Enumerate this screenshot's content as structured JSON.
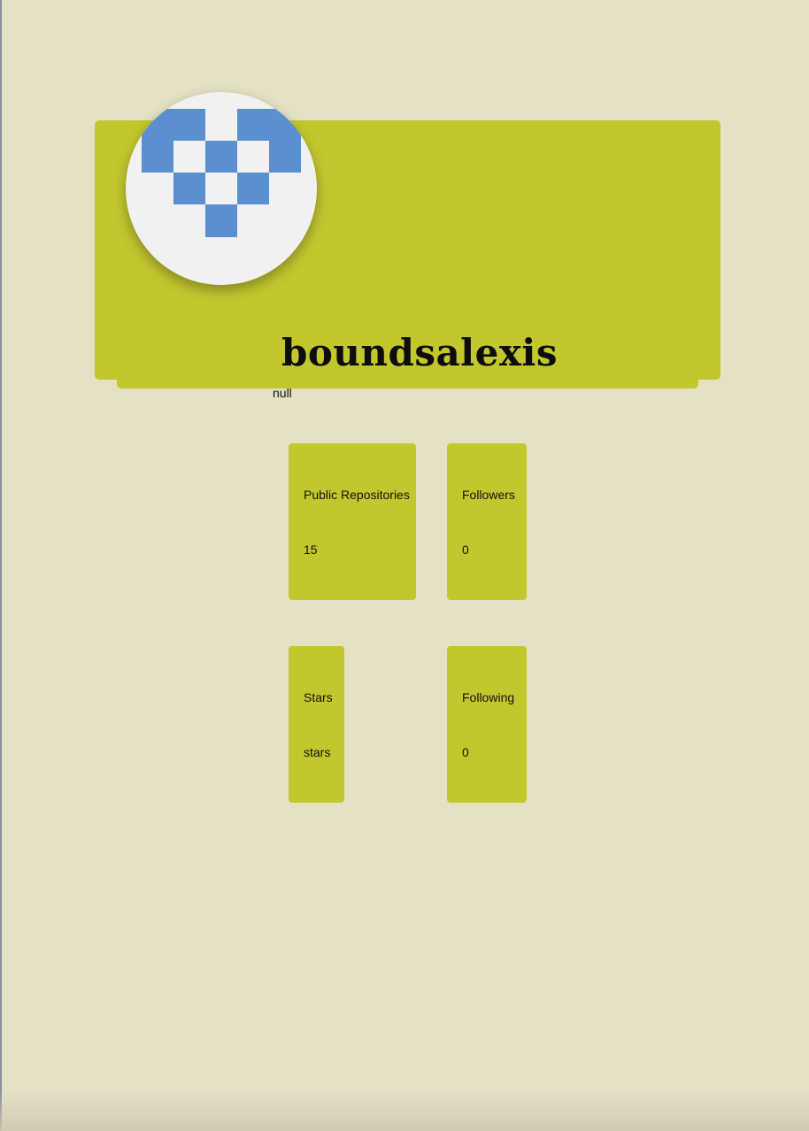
{
  "profile": {
    "username": "boundsalexis",
    "bio": "null",
    "avatar_icon": "identicon-avatar"
  },
  "stats": {
    "public_repos": {
      "label": "Public Repositories",
      "value": "15"
    },
    "followers": {
      "label": "Followers",
      "value": "0"
    },
    "stars": {
      "label": "Stars",
      "value": "stars"
    },
    "following": {
      "label": "Following",
      "value": "0"
    }
  },
  "colors": {
    "page_background": "#e4e1c5",
    "accent": "#c3c72e",
    "avatar_pattern": "#5b8fcf",
    "avatar_background": "#f1f1f1"
  }
}
